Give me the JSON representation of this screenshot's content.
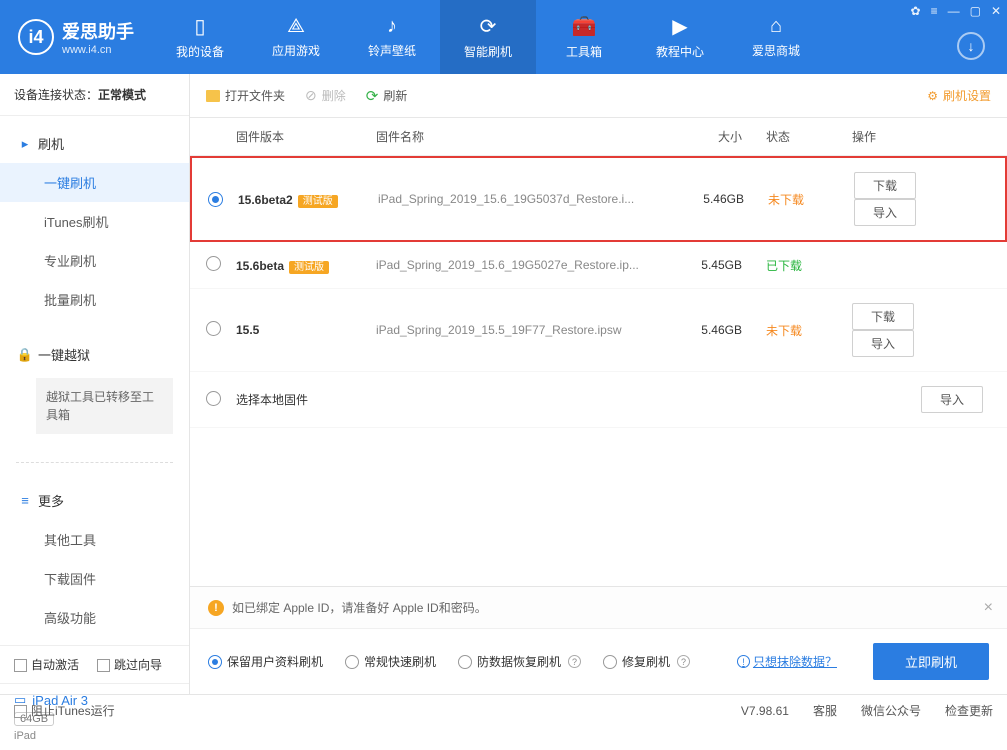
{
  "app": {
    "title": "爱思助手",
    "sub": "www.i4.cn"
  },
  "winControls": [
    "✿",
    "≡",
    "—",
    "▢",
    "✕"
  ],
  "nav": [
    {
      "icon": "▯",
      "label": "我的设备"
    },
    {
      "icon": "⟁",
      "label": "应用游戏"
    },
    {
      "icon": "♪",
      "label": "铃声壁纸"
    },
    {
      "icon": "⟳",
      "label": "智能刷机",
      "active": true
    },
    {
      "icon": "🧰",
      "label": "工具箱"
    },
    {
      "icon": "▶",
      "label": "教程中心"
    },
    {
      "icon": "⌂",
      "label": "爱思商城"
    }
  ],
  "downloadIcon": "↓",
  "connStatus": {
    "label": "设备连接状态：",
    "value": "正常模式"
  },
  "sidebar": {
    "flashTitle": "刷机",
    "flashItems": [
      "一键刷机",
      "iTunes刷机",
      "专业刷机",
      "批量刷机"
    ],
    "jailbreakTitle": "一键越狱",
    "jailbreakNote": "越狱工具已转移至工具箱",
    "moreTitle": "更多",
    "moreItems": [
      "其他工具",
      "下载固件",
      "高级功能"
    ]
  },
  "autoRow": {
    "autoActivate": "自动激活",
    "skipGuide": "跳过向导"
  },
  "device": {
    "name": "iPad Air 3",
    "storage": "64GB",
    "type": "iPad"
  },
  "toolbar": {
    "openFolder": "打开文件夹",
    "delete": "删除",
    "refresh": "刷新",
    "settings": "刷机设置"
  },
  "table": {
    "head": {
      "version": "固件版本",
      "name": "固件名称",
      "size": "大小",
      "status": "状态",
      "ops": "操作"
    },
    "rows": [
      {
        "selected": true,
        "highlight": true,
        "version": "15.6beta2",
        "tag": "测试版",
        "name": "iPad_Spring_2019_15.6_19G5037d_Restore.i...",
        "size": "5.46GB",
        "status": "未下载",
        "statusClass": "not",
        "download": "下载",
        "import": "导入"
      },
      {
        "selected": false,
        "version": "15.6beta",
        "tag": "测试版",
        "name": "iPad_Spring_2019_15.6_19G5027e_Restore.ip...",
        "size": "5.45GB",
        "status": "已下载",
        "statusClass": "done"
      },
      {
        "selected": false,
        "version": "15.5",
        "name": "iPad_Spring_2019_15.5_19F77_Restore.ipsw",
        "size": "5.46GB",
        "status": "未下载",
        "statusClass": "not",
        "download": "下载",
        "import": "导入"
      },
      {
        "selected": false,
        "localLabel": "选择本地固件",
        "import": "导入"
      }
    ]
  },
  "warn": {
    "text": "如已绑定 Apple ID，请准备好 Apple ID和密码。"
  },
  "opts": {
    "o1": "保留用户资料刷机",
    "o2": "常规快速刷机",
    "o3": "防数据恢复刷机",
    "o4": "修复刷机",
    "eraseLink": "只想抹除数据？",
    "flashBtn": "立即刷机"
  },
  "footer": {
    "blockItunes": "阻止iTunes运行",
    "version": "V7.98.61",
    "kefu": "客服",
    "wechat": "微信公众号",
    "update": "检查更新"
  }
}
